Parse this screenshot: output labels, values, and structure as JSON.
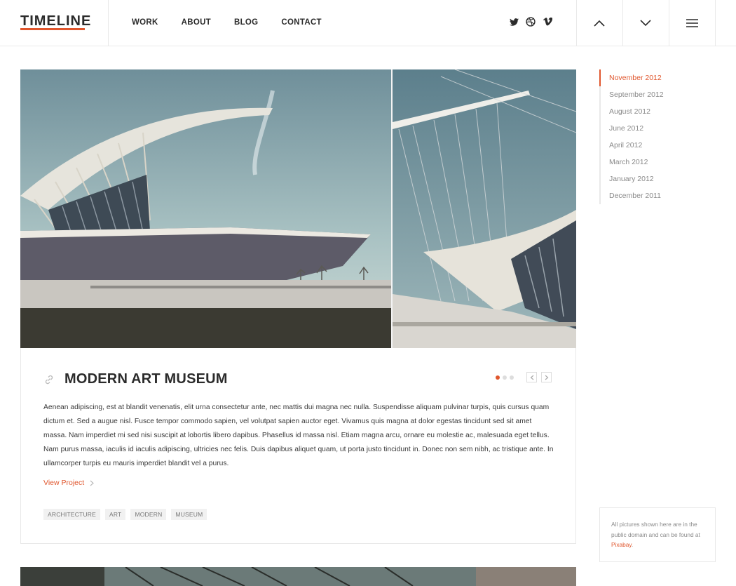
{
  "header": {
    "logo": "TIMELINE",
    "nav": [
      "WORK",
      "ABOUT",
      "BLOG",
      "CONTACT"
    ],
    "social_icons": [
      "twitter-icon",
      "dribbble-icon",
      "vimeo-icon"
    ],
    "buttons": [
      "chevron-up-icon",
      "chevron-down-icon",
      "menu-icon"
    ]
  },
  "post": {
    "title": "MODERN ART MUSEUM",
    "description": "Aenean adipiscing, est at blandit venenatis, elit urna consectetur ante, nec mattis dui magna nec nulla. Suspendisse aliquam pulvinar turpis, quis cursus quam dictum et. Sed a augue nisl. Fusce tempor commodo sapien, vel volutpat sapien auctor eget. Vivamus quis magna at dolor egestas tincidunt sed sit amet massa. Nam imperdiet mi sed nisi suscipit at lobortis libero dapibus. Phasellus id massa nisl. Etiam magna arcu, ornare eu molestie ac, malesuada eget tellus. Nam purus massa, iaculis id iaculis adipiscing, ultricies nec felis. Duis dapibus aliquet quam, ut porta justo tincidunt in. Donec non sem nibh, ac tristique ante. In ullamcorper turpis eu mauris imperdiet blandit vel a purus.",
    "view_project": "View Project",
    "tags": [
      "ARCHITECTURE",
      "ART",
      "MODERN",
      "MUSEUM"
    ],
    "slide_count": 3,
    "active_slide": 1
  },
  "timeline": {
    "items": [
      "November 2012",
      "September 2012",
      "August 2012",
      "June 2012",
      "April 2012",
      "March 2012",
      "January 2012",
      "December 2011"
    ],
    "active_index": 0
  },
  "note": {
    "text_before": "All pictures shown here are in the public domain and can be found at ",
    "link": "Pixabay",
    "text_after": "."
  },
  "colors": {
    "accent": "#e0562d",
    "text": "#2b2b2b",
    "muted": "#8a8a8a"
  }
}
